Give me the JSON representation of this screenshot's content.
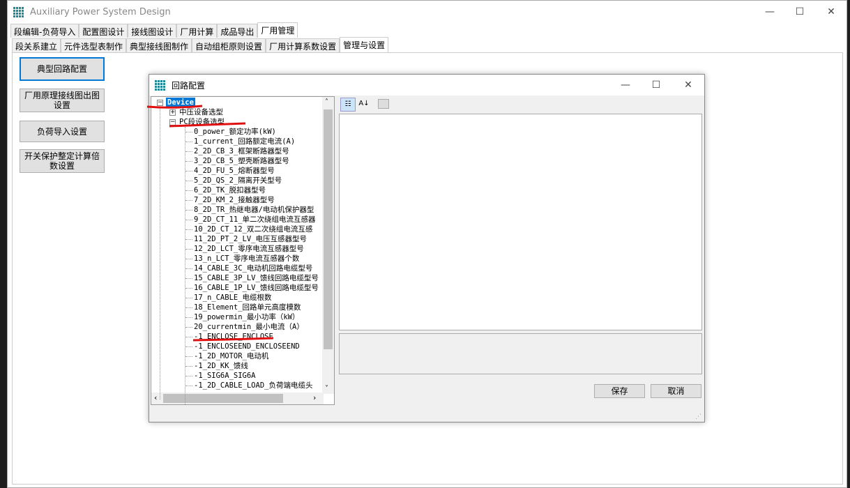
{
  "window": {
    "title": "Auxiliary Power System Design",
    "minimize": "—",
    "maximize": "☐",
    "close": "✕"
  },
  "main_tabs": [
    {
      "label": "段编辑-负荷导入"
    },
    {
      "label": "配置图设计"
    },
    {
      "label": "接线图设计"
    },
    {
      "label": "厂用计算"
    },
    {
      "label": "成品导出"
    },
    {
      "label": "厂用管理",
      "selected": true
    }
  ],
  "sub_tabs": [
    {
      "label": "段关系建立"
    },
    {
      "label": "元件选型表制作"
    },
    {
      "label": "典型接线图制作"
    },
    {
      "label": "自动组柜原则设置"
    },
    {
      "label": "厂用计算系数设置"
    },
    {
      "label": "管理与设置",
      "selected": true
    }
  ],
  "left_buttons": [
    {
      "label": "典型回路配置",
      "selected": true
    },
    {
      "label": "厂用原理接线图出图设置"
    },
    {
      "label": "负荷导入设置"
    },
    {
      "label": "开关保护整定计算倍数设置"
    }
  ],
  "dialog": {
    "title": "回路配置",
    "minimize": "—",
    "maximize": "☐",
    "close": "✕",
    "tree": {
      "root": "Device",
      "nodes": [
        {
          "label": "中压设备选型",
          "expanded": false
        },
        {
          "label": "PC段设备选型",
          "expanded": true
        }
      ],
      "children": [
        "0_power_额定功率(kW)",
        "1_current_回路额定电流(A)",
        "2_2D_CB_3_框架断路器型号",
        "3_2D_CB_5_塑壳断路器型号",
        "4_2D_FU_5_熔断器型号",
        "5_2D_QS_2_隔离开关型号",
        "6_2D_TK_脱扣器型号",
        "7_2D_KM_2_接触器型号",
        "8_2D_TR_热继电器/电动机保护器型",
        "9_2D_CT_11_单二次绕组电流互感器",
        "10_2D_CT_12_双二次绕组电流互感",
        "11_2D_PT_2_LV_电压互感器型号",
        "12_2D_LCT_零序电流互感器型号",
        "13_n_LCT_零序电流互感器个数",
        "14_CABLE_3C_电动机回路电缆型号",
        "15_CABLE_3P_LV_馈线回路电缆型号",
        "16_CABLE_1P_LV_馈线回路电缆型号",
        "17_n_CABLE_电缆根数",
        "18_Element_回路单元高度模数",
        "19_powermin_最小功率（kW）",
        "20_currentmin_最小电流（A）",
        "-1_ENCLOSE_ENCLOSE",
        "-1_ENCLOSEEND_ENCLOSEEND",
        "-1_2D_MOTOR_电动机",
        "-1_2D_KK_馈线",
        "-1_SIG6A_SIG6A",
        "-1_2D_CABLE_LOAD_负荷端电缆头"
      ]
    },
    "save": "保存",
    "cancel": "取消"
  },
  "colors": {
    "selection": "#0078d7",
    "annotation": "#e01010"
  }
}
